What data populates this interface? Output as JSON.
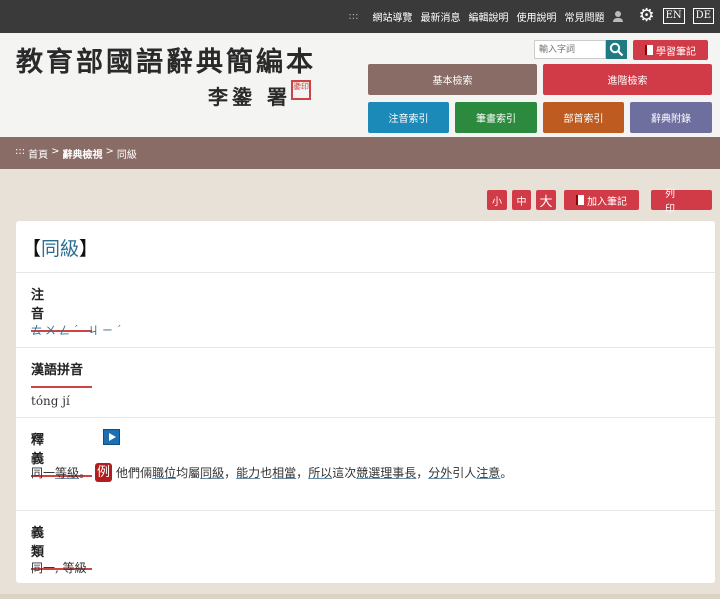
{
  "topnav": {
    "dots": ":::",
    "items": [
      "網站導覽",
      "最新消息",
      "編輯說明",
      "使用說明",
      "常見問題"
    ],
    "lang": [
      "EN",
      "DE"
    ]
  },
  "header": {
    "title": "教育部國語辭典簡編本",
    "signature": "李鍌 署",
    "seal": "鍌印",
    "search_placeholder": "輸入字詞",
    "notes_label": "學習筆記"
  },
  "nav": {
    "basic": "基本檢索",
    "advanced": "進階檢索",
    "zhuyin_index": "注音索引",
    "stroke_index": "筆畫索引",
    "radical_index": "部首索引",
    "appendix": "辭典附錄"
  },
  "breadcrumb": {
    "dots": ":::",
    "home": "首頁",
    "sep1": ">",
    "view": "辭典檢視",
    "sep2": ">",
    "current": "同級"
  },
  "tools": {
    "small": "小",
    "medium": "中",
    "large": "大",
    "add_note": "加入筆記",
    "print": "列印"
  },
  "entry": {
    "open_bracket": "【",
    "word": "同級",
    "close_bracket": "】",
    "zhuyin_title": "注音",
    "zhuyin": "ㄊㄨㄥˊ ㄐㄧˊ",
    "pinyin_title": "漢語拼音",
    "pinyin": "tóng jí",
    "definition_title": "釋義",
    "def_prefix": "同一",
    "def_link1": "等級",
    "def_end1": "。",
    "example_badge": "例",
    "ex_parts": [
      "他們倆",
      "職位",
      "均屬",
      "同級",
      "，",
      "能力",
      "也",
      "相當",
      "，",
      "所以",
      "這次",
      "競選",
      "理事長",
      "，",
      "分外",
      "引人",
      "注意",
      "。"
    ],
    "synonyms_title": "義類",
    "synonyms": "同一, 等級"
  }
}
